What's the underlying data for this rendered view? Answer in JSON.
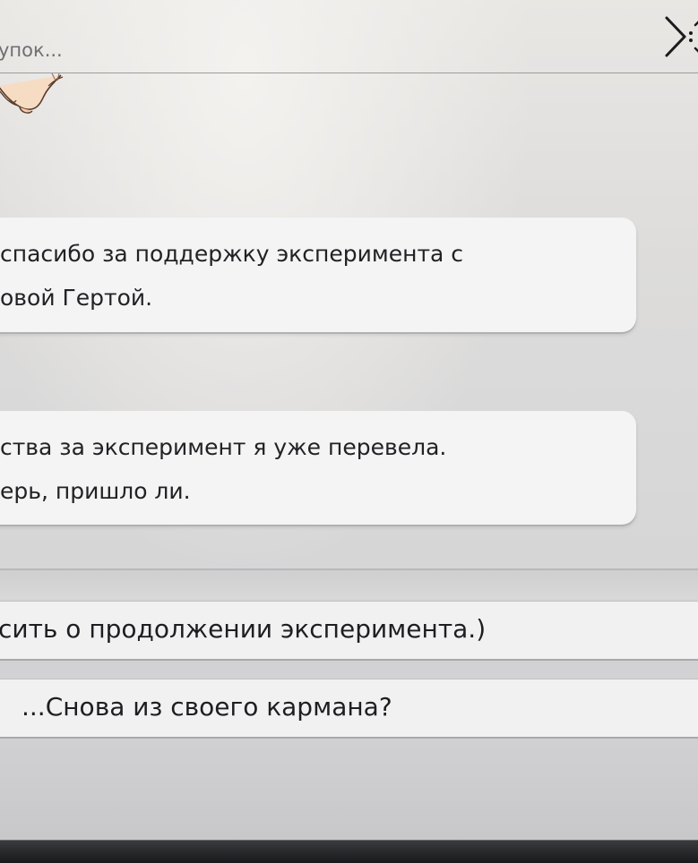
{
  "header": {
    "title": "упок..."
  },
  "dialogue": [
    {
      "line1": "спасибо за поддержку эксперимента с",
      "line2": "овой Гертой."
    },
    {
      "line1": "ства за эксперимент я уже перевела.",
      "line2": "ерь, пришло ли."
    }
  ],
  "choices": [
    {
      "label": "сить о продолжении эксперимента.)"
    },
    {
      "label": "...Снова из своего кармана?"
    }
  ],
  "icons": {
    "close": "close-x-icon",
    "sprite": "creature-paw-sprite"
  },
  "colors": {
    "bubble": "#f4f4f4",
    "choice": "#f1f1f1",
    "text": "#222226",
    "title": "#6f6f72"
  }
}
